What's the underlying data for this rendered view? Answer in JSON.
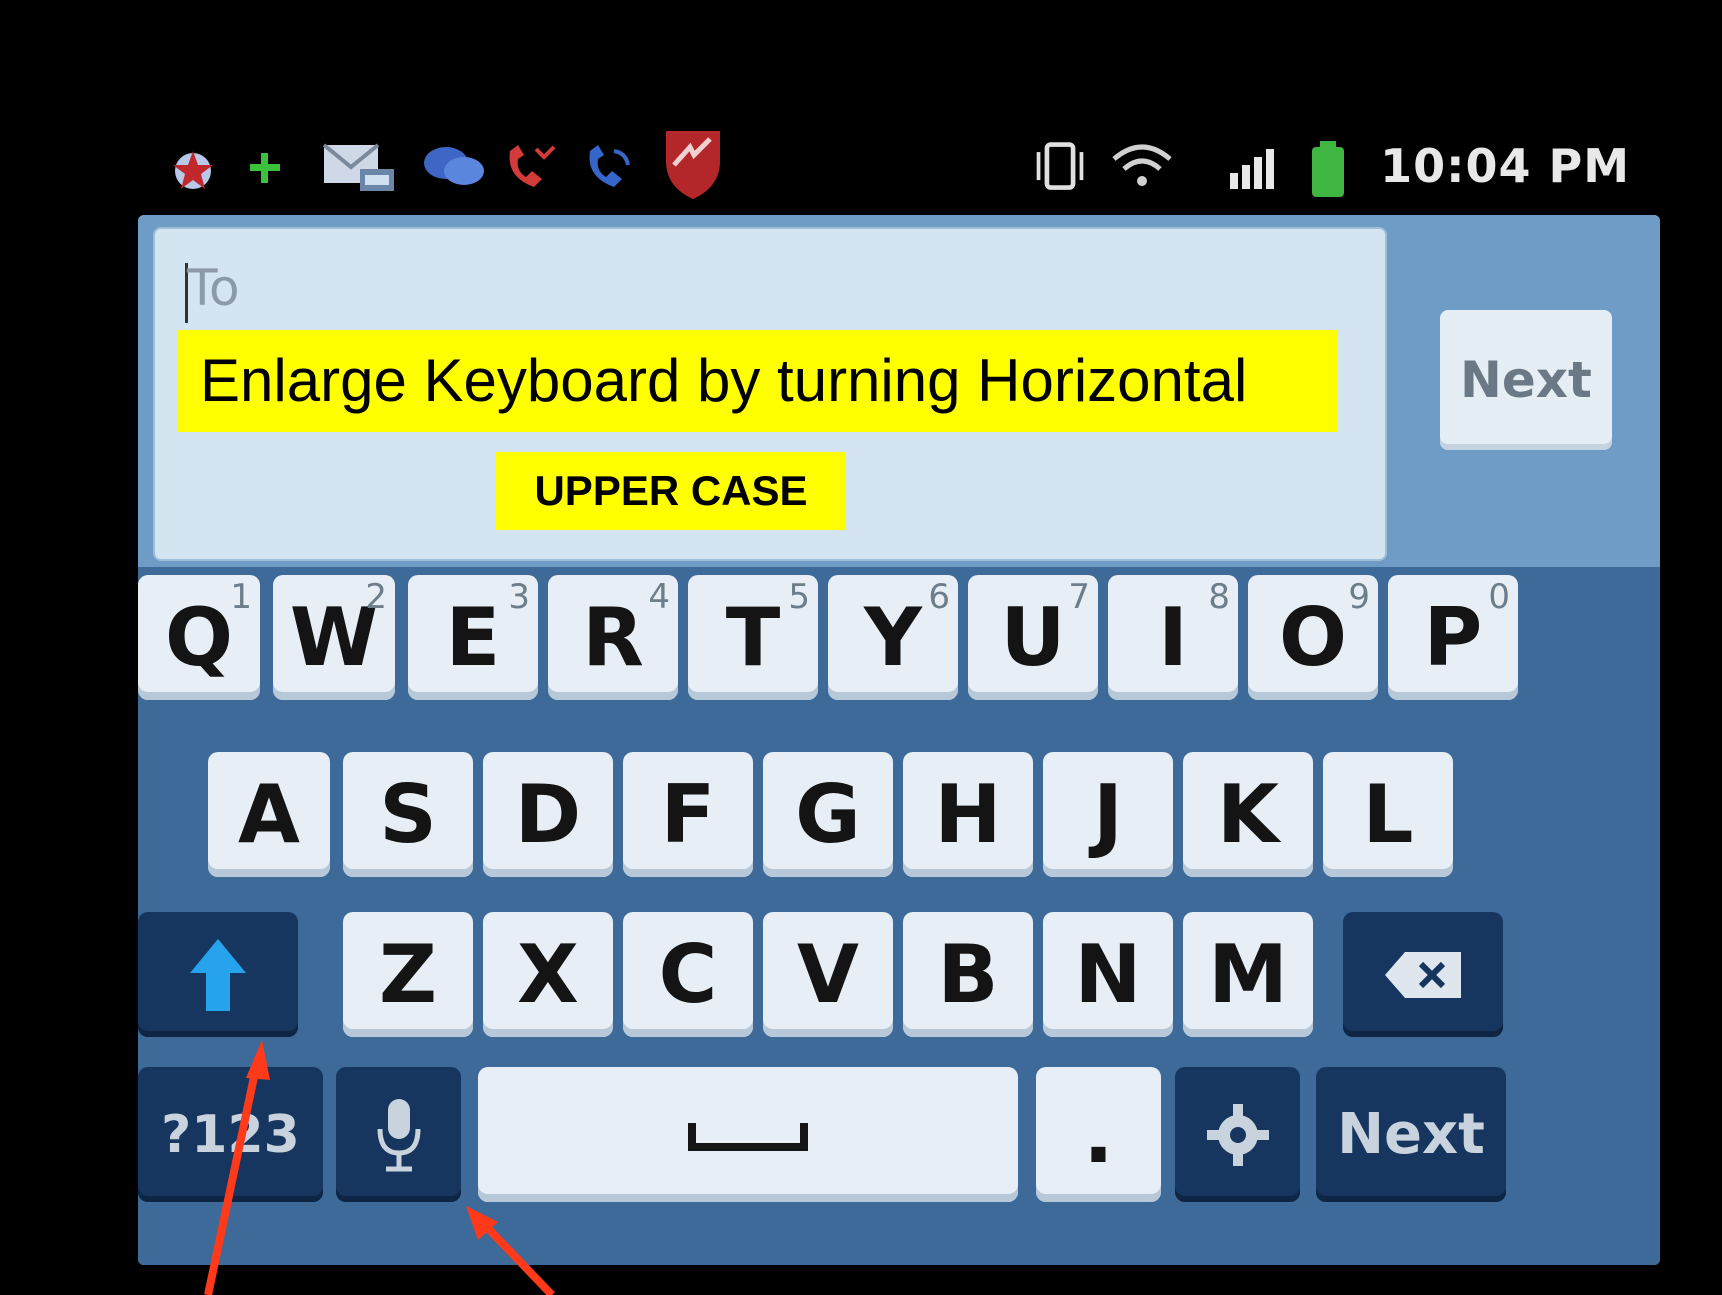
{
  "status_bar": {
    "time": "10:04 PM",
    "icons": [
      "star-badge-icon",
      "plus-icon",
      "email-icon",
      "chat-icon",
      "missed-call-icon",
      "call-icon",
      "shield-app-icon",
      "vibrate-icon",
      "wifi-icon",
      "signal-icon",
      "battery-icon"
    ]
  },
  "compose": {
    "to_placeholder": "To",
    "next_label": "Next"
  },
  "annotations": {
    "headline": "Enlarge Keyboard by turning Horizontal",
    "case_label": "UPPER CASE"
  },
  "keyboard": {
    "row1": [
      {
        "label": "Q",
        "hint": "1"
      },
      {
        "label": "W",
        "hint": "2"
      },
      {
        "label": "E",
        "hint": "3"
      },
      {
        "label": "R",
        "hint": "4"
      },
      {
        "label": "T",
        "hint": "5"
      },
      {
        "label": "Y",
        "hint": "6"
      },
      {
        "label": "U",
        "hint": "7"
      },
      {
        "label": "I",
        "hint": "8"
      },
      {
        "label": "O",
        "hint": "9"
      },
      {
        "label": "P",
        "hint": "0"
      }
    ],
    "row2": [
      "A",
      "S",
      "D",
      "F",
      "G",
      "H",
      "J",
      "K",
      "L"
    ],
    "row3": [
      "Z",
      "X",
      "C",
      "V",
      "B",
      "N",
      "M"
    ],
    "symbols_label": "?123",
    "period_label": ".",
    "next_label": "Next"
  },
  "colors": {
    "annotation_bg": "#ffff00",
    "arrow": "#ff3a1a",
    "keyboard_bg": "#3d6a99"
  }
}
